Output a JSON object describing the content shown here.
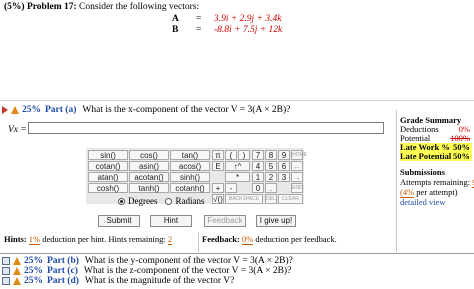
{
  "problem": {
    "weight": "(5%)",
    "title": "Problem 17:",
    "prompt": "Consider the following vectors:",
    "vectors": [
      {
        "name": "A",
        "eq": "=",
        "expr": "3.9i + 2.9j + 3.4k"
      },
      {
        "name": "B",
        "eq": "=",
        "expr": "-8.8i + 7.5j + 12k"
      }
    ]
  },
  "part_a": {
    "percent": "25%",
    "label": "Part (a)",
    "question": "What is the x-component of the vector V = 3(A × 2B)?",
    "answer_label": "Vx =",
    "answer_value": ""
  },
  "keypad": {
    "keys": [
      "sin()",
      "cos()",
      "tan()",
      "π",
      "(",
      ")",
      "7",
      "8",
      "9",
      "HOME",
      "cotan()",
      "asin()",
      "acos()",
      "E",
      "↑^",
      "4",
      "5",
      "6",
      "←",
      "atan()",
      "acotan()",
      "sinh()",
      "*",
      "1",
      "2",
      "3",
      "→",
      "cosh()",
      "tanh()",
      "cotanh()",
      "+",
      "-",
      "0",
      ".",
      "END",
      "√()",
      "BACKSPACE",
      "DEL",
      "CLEAR"
    ],
    "angle_modes": [
      "Degrees",
      "Radians"
    ],
    "selected_mode": "Degrees"
  },
  "buttons": {
    "submit": "Submit",
    "hint": "Hint",
    "feedback": "Feedback",
    "give_up": "I give up!"
  },
  "hints": {
    "label": "Hints:",
    "pct": "1%",
    "text": "deduction per hint. Hints remaining:",
    "remaining": "2"
  },
  "feedback": {
    "label": "Feedback:",
    "pct": "0%",
    "text": "deduction per feedback."
  },
  "grade_summary": {
    "title": "Grade Summary",
    "deductions_label": "Deductions",
    "deductions_value": "0%",
    "potential_label": "Potential",
    "potential_value": "100%",
    "late_work_label": "Late Work %",
    "late_work_value": "50%",
    "late_potential_label": "Late Potential",
    "late_potential_value": "50%"
  },
  "submissions": {
    "title": "Submissions",
    "attempts_label": "Attempts remaining:",
    "attempts_value": "9",
    "per_attempt_pct": "(4%",
    "per_attempt_text": "per attempt)",
    "detailed_view": "detailed view"
  },
  "other_parts": [
    {
      "percent": "25%",
      "label": "Part (b)",
      "question": "What is the y-component of the vector V = 3(A × 2B)?"
    },
    {
      "percent": "25%",
      "label": "Part (c)",
      "question": "What is the z-component of the vector V = 3(A × 2B)?"
    },
    {
      "percent": "25%",
      "label": "Part (d)",
      "question": "What is the magnitude of the vector V?"
    }
  ]
}
